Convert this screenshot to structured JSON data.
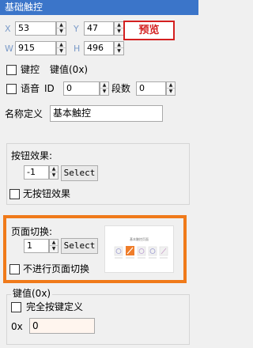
{
  "header": {
    "title": "基础触控"
  },
  "position": {
    "x_label": "X",
    "x_value": "53",
    "y_label": "Y",
    "y_value": "47",
    "w_label": "W",
    "w_value": "915",
    "h_label": "H",
    "h_value": "496"
  },
  "preview_button": "预览",
  "keyctrl": {
    "label": "键控",
    "keyvalue_label": "键值(0x)"
  },
  "voice": {
    "label": "语音",
    "id_label": "ID",
    "id_value": "0",
    "segments_label": "段数",
    "segments_value": "0"
  },
  "name": {
    "label": "名称定义",
    "value": "基本触控"
  },
  "button_effect": {
    "label": "按钮效果:",
    "value": "-1",
    "select_label": "Select",
    "no_effect_label": "无按钮效果"
  },
  "page_switch": {
    "label": "页面切换:",
    "value": "1",
    "select_label": "Select",
    "no_switch_label": "不进行页面切换",
    "thumbnail_title": "基本触控页面",
    "colors": {
      "highlight_border": "#f07a1a"
    }
  },
  "key_value": {
    "group_label": "键值(0x)",
    "full_key_label": "完全按键定义",
    "prefix": "0x",
    "value": "0"
  },
  "colors": {
    "header_bg": "#3b75c9",
    "preview_text": "#d42020",
    "input_tint": "#fff5ee"
  }
}
